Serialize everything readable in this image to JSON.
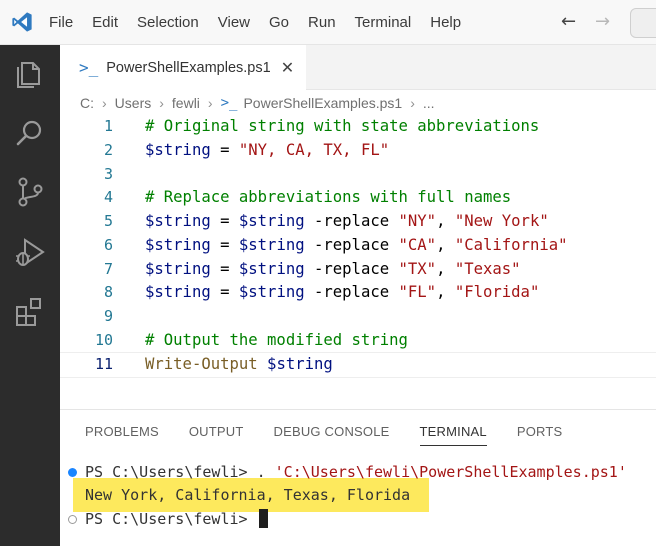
{
  "menu": [
    "File",
    "Edit",
    "Selection",
    "View",
    "Go",
    "Run",
    "Terminal",
    "Help"
  ],
  "nav": {
    "back": "←",
    "forward": "→"
  },
  "tab": {
    "icon": ">_",
    "label": "PowerShellExamples.ps1",
    "close": "✕"
  },
  "breadcrumb": {
    "drive": "C:",
    "users": "Users",
    "user": "fewli",
    "icon": ">_",
    "file": "PowerShellExamples.ps1",
    "more": "..."
  },
  "code": {
    "line_numbers": [
      "1",
      "2",
      "3",
      "4",
      "5",
      "6",
      "7",
      "8",
      "9",
      "10",
      "11"
    ],
    "l1": "# Original string with state abbreviations",
    "l2_var": "$string",
    "l2_op": " = ",
    "l2_str": "\"NY, CA, TX, FL\"",
    "l4": "# Replace abbreviations with full names",
    "l5_a": "$string",
    "l5_b": " = ",
    "l5_c": "$string",
    "l5_d": " -replace ",
    "l5_e": "\"NY\"",
    "l5_f": ", ",
    "l5_g": "\"New York\"",
    "l6_a": "$string",
    "l6_b": " = ",
    "l6_c": "$string",
    "l6_d": " -replace ",
    "l6_e": "\"CA\"",
    "l6_f": ", ",
    "l6_g": "\"California\"",
    "l7_a": "$string",
    "l7_b": " = ",
    "l7_c": "$string",
    "l7_d": " -replace ",
    "l7_e": "\"TX\"",
    "l7_f": ", ",
    "l7_g": "\"Texas\"",
    "l8_a": "$string",
    "l8_b": " = ",
    "l8_c": "$string",
    "l8_d": " -replace ",
    "l8_e": "\"FL\"",
    "l8_f": ", ",
    "l8_g": "\"Florida\"",
    "l10": "# Output the modified string",
    "l11_cmd": "Write-Output",
    "l11_var": " $string"
  },
  "panel": {
    "tabs": [
      "PROBLEMS",
      "OUTPUT",
      "DEBUG CONSOLE",
      "TERMINAL",
      "PORTS"
    ],
    "active_tab": "TERMINAL"
  },
  "terminal": {
    "prompt1": "PS C:\\Users\\fewli> . ",
    "path1": "'C:\\Users\\fewli\\PowerShellExamples.ps1'",
    "output": "New York, California, Texas, Florida",
    "prompt2": "PS C:\\Users\\fewli> "
  },
  "colors": {
    "highlight": "#fde95d",
    "activity_bar": "#2c2c2c",
    "accent": "#1a85ff"
  }
}
